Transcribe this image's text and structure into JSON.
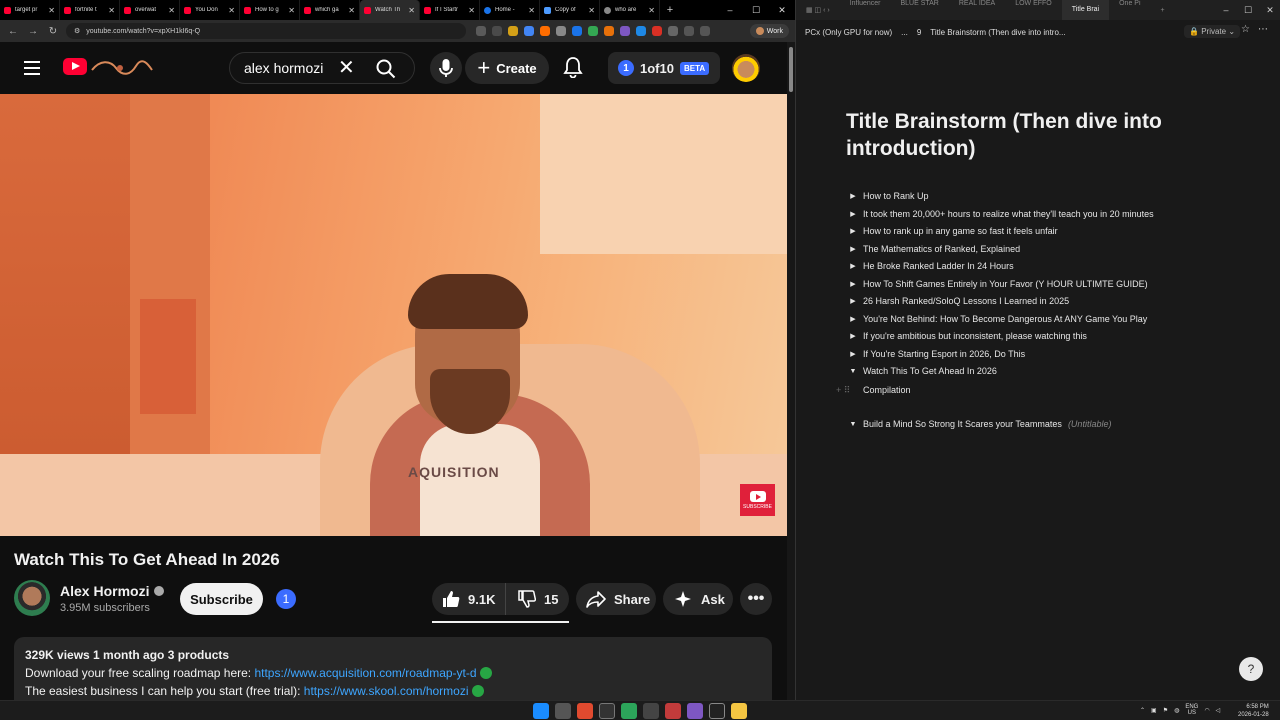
{
  "browser_left": {
    "tabs": [
      {
        "label": "target pr",
        "icon": "youtube-icon"
      },
      {
        "label": "fortnite t",
        "icon": "youtube-icon"
      },
      {
        "label": "overwat",
        "icon": "youtube-icon"
      },
      {
        "label": "You Don",
        "icon": "youtube-icon"
      },
      {
        "label": "How to g",
        "icon": "youtube-icon"
      },
      {
        "label": "which ga",
        "icon": "youtube-icon"
      },
      {
        "label": "Watch Th",
        "icon": "youtube-icon",
        "active": true
      },
      {
        "label": "If I Startr",
        "icon": "youtube-icon"
      },
      {
        "label": "Home -",
        "icon": "globe-icon"
      },
      {
        "label": "Copy of",
        "icon": "doc-icon"
      },
      {
        "label": "who are",
        "icon": "web-icon"
      }
    ],
    "url": "youtube.com/watch?v=xpXH1kI6q-Q",
    "profile_label": "Work"
  },
  "youtube": {
    "search_query": "alex hormozi",
    "create_label": "Create",
    "extension_label": "1of10",
    "extension_badge": "1",
    "beta_label": "BETA",
    "video_overlay_text": "AQUISITION",
    "subscribe_overlay_label": "SUBSCRIBE",
    "video_title": "Watch This To Get Ahead In 2026",
    "channel_name": "Alex Hormozi",
    "subscribers": "3.95M subscribers",
    "subscribe_label": "Subscribe",
    "channel_badge": "1",
    "likes": "9.1K",
    "dislikes": "15",
    "share_label": "Share",
    "ask_label": "Ask",
    "more_label": "•••",
    "description": {
      "meta": "329K views  1 month ago  3 products",
      "line1_text": "Download your free scaling roadmap here: ",
      "line1_link": "https://www.acquisition.com/roadmap-yt-d",
      "line2_text": "The easiest business I can help you start (free trial): ",
      "line2_link": "https://www.skool.com/hormozi"
    }
  },
  "browser_right": {
    "tabs": [
      "Influencer",
      "BLUE STAR",
      "REAL IDEA",
      "LOW EFFO",
      "Title Brai",
      "One Pi"
    ],
    "active_tab": "Title Brai",
    "breadcrumb": [
      "PCx (Only GPU for now)",
      "...",
      "9",
      "Title Brainstorm (Then dive into intro..."
    ],
    "privacy_label": "Private",
    "page_title": "Title Brainstorm (Then dive into introduction)",
    "toggles": [
      {
        "label": "How to Rank Up",
        "open": false
      },
      {
        "label": "It took them 20,000+ hours to realize what they'll teach you in 20 minutes",
        "open": false
      },
      {
        "label": "How to rank up in any game so fast it feels unfair",
        "open": false
      },
      {
        "label": "The Mathematics of Ranked, Explained",
        "open": false
      },
      {
        "label": "He Broke Ranked Ladder In 24 Hours",
        "open": false
      },
      {
        "label": "How To Shift Games Entirely in Your Favor (Y HOUR ULTIMTE GUIDE)",
        "open": false
      },
      {
        "label": "26 Harsh Ranked/SoloQ Lessons I Learned in 2025",
        "open": false
      },
      {
        "label": "You're Not Behind: How To Become Dangerous At ANY Game You Play",
        "open": false
      },
      {
        "label": "If you're ambitious but inconsistent, please watching this",
        "open": false
      },
      {
        "label": "If You're Starting Esport in 2026, Do This",
        "open": false
      },
      {
        "label": "Watch This To Get Ahead In 2026",
        "open": true
      }
    ],
    "child_item": "Compilation",
    "last_toggle": {
      "label": "Build a Mind So Strong It Scares your Teammates",
      "suffix": "(Untitlable)"
    },
    "help_label": "?"
  },
  "taskbar": {
    "tray_lang": "ENG",
    "tray_region": "US",
    "clock_time": "6:58 PM",
    "clock_date": "2026-01-28"
  },
  "colors": {
    "yt_red": "#ff0033",
    "accent_blue": "#3b6cff",
    "link_blue": "#3ea6ff",
    "notion_bg": "#191919",
    "yt_bg": "#0f0f0f"
  }
}
